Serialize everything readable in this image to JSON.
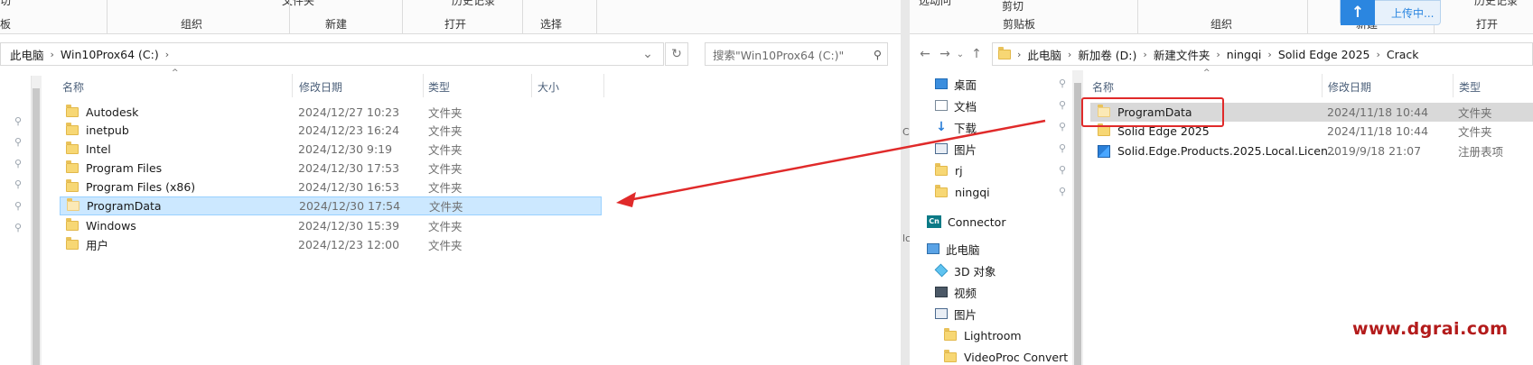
{
  "left_window": {
    "ribbon": {
      "top_fragments": [
        "切",
        "文件夹",
        "历史记录"
      ],
      "groups": [
        "板",
        "组织",
        "新建",
        "打开",
        "选择"
      ]
    },
    "address": {
      "crumbs": [
        "此电脑",
        "Win10Prox64 (C:)"
      ]
    },
    "search_placeholder": "搜索\"Win10Prox64 (C:)\"",
    "columns": {
      "name": "名称",
      "date": "修改日期",
      "type": "类型",
      "size": "大小"
    },
    "rows": [
      {
        "name": "Autodesk",
        "date": "2024/12/27 10:23",
        "type": "文件夹"
      },
      {
        "name": "inetpub",
        "date": "2024/12/23 16:24",
        "type": "文件夹"
      },
      {
        "name": "Intel",
        "date": "2024/12/30 9:19",
        "type": "文件夹"
      },
      {
        "name": "Program Files",
        "date": "2024/12/30 17:53",
        "type": "文件夹"
      },
      {
        "name": "Program Files (x86)",
        "date": "2024/12/30 16:53",
        "type": "文件夹"
      },
      {
        "name": "ProgramData",
        "date": "2024/12/30 17:54",
        "type": "文件夹",
        "selected": true
      },
      {
        "name": "Windows",
        "date": "2024/12/30 15:39",
        "type": "文件夹"
      },
      {
        "name": "用户",
        "date": "2024/12/23 12:00",
        "type": "文件夹"
      }
    ]
  },
  "right_window": {
    "ribbon": {
      "top_fragments": [
        "选动问",
        "剪切",
        "历史记录"
      ],
      "groups": [
        "剪贴板",
        "组织",
        "新建",
        "打开"
      ]
    },
    "upload": {
      "label": "上传中..."
    },
    "address": {
      "crumbs": [
        "此电脑",
        "新加卷 (D:)",
        "新建文件夹",
        "ningqi",
        "Solid Edge 2025",
        "Crack"
      ]
    },
    "nav_items": [
      {
        "label": "桌面",
        "icon": "desktop-icon",
        "pinned": true
      },
      {
        "label": "文档",
        "icon": "document-icon",
        "pinned": true
      },
      {
        "label": "下载",
        "icon": "download-icon",
        "pinned": true
      },
      {
        "label": "图片",
        "icon": "pictures-icon",
        "pinned": true
      },
      {
        "label": "rj",
        "icon": "folder-icon",
        "pinned": true
      },
      {
        "label": "ningqi",
        "icon": "folder-icon",
        "pinned": true
      },
      {
        "label": "Connector",
        "icon": "connector-icon",
        "pinned": false
      },
      {
        "label": "此电脑",
        "icon": "this-pc-icon",
        "pinned": false
      },
      {
        "label": "3D 对象",
        "icon": "3d-objects-icon",
        "pinned": false
      },
      {
        "label": "视频",
        "icon": "videos-icon",
        "pinned": false
      },
      {
        "label": "图片",
        "icon": "pictures-icon",
        "pinned": false
      },
      {
        "label": "Lightroom",
        "icon": "folder-icon",
        "pinned": false
      },
      {
        "label": "VideoProc Convert",
        "icon": "folder-icon",
        "pinned": false
      }
    ],
    "columns": {
      "name": "名称",
      "date": "修改日期",
      "type": "类型"
    },
    "rows": [
      {
        "name": "ProgramData",
        "date": "2024/11/18 10:44",
        "type": "文件夹",
        "highlighted": true
      },
      {
        "name": "Solid Edge 2025",
        "date": "2024/11/18 10:44",
        "type": "文件夹"
      },
      {
        "name": "Solid.Edge.Products.2025.Local.Licen...",
        "date": "2019/9/18 21:07",
        "type": "注册表项"
      }
    ]
  },
  "watermark": "www.dgrai.com",
  "colors": {
    "selection_bg": "#cce8ff",
    "annotation_red": "#e02a2a",
    "watermark": "#b31b1b",
    "accent_blue": "#2b86e0"
  }
}
